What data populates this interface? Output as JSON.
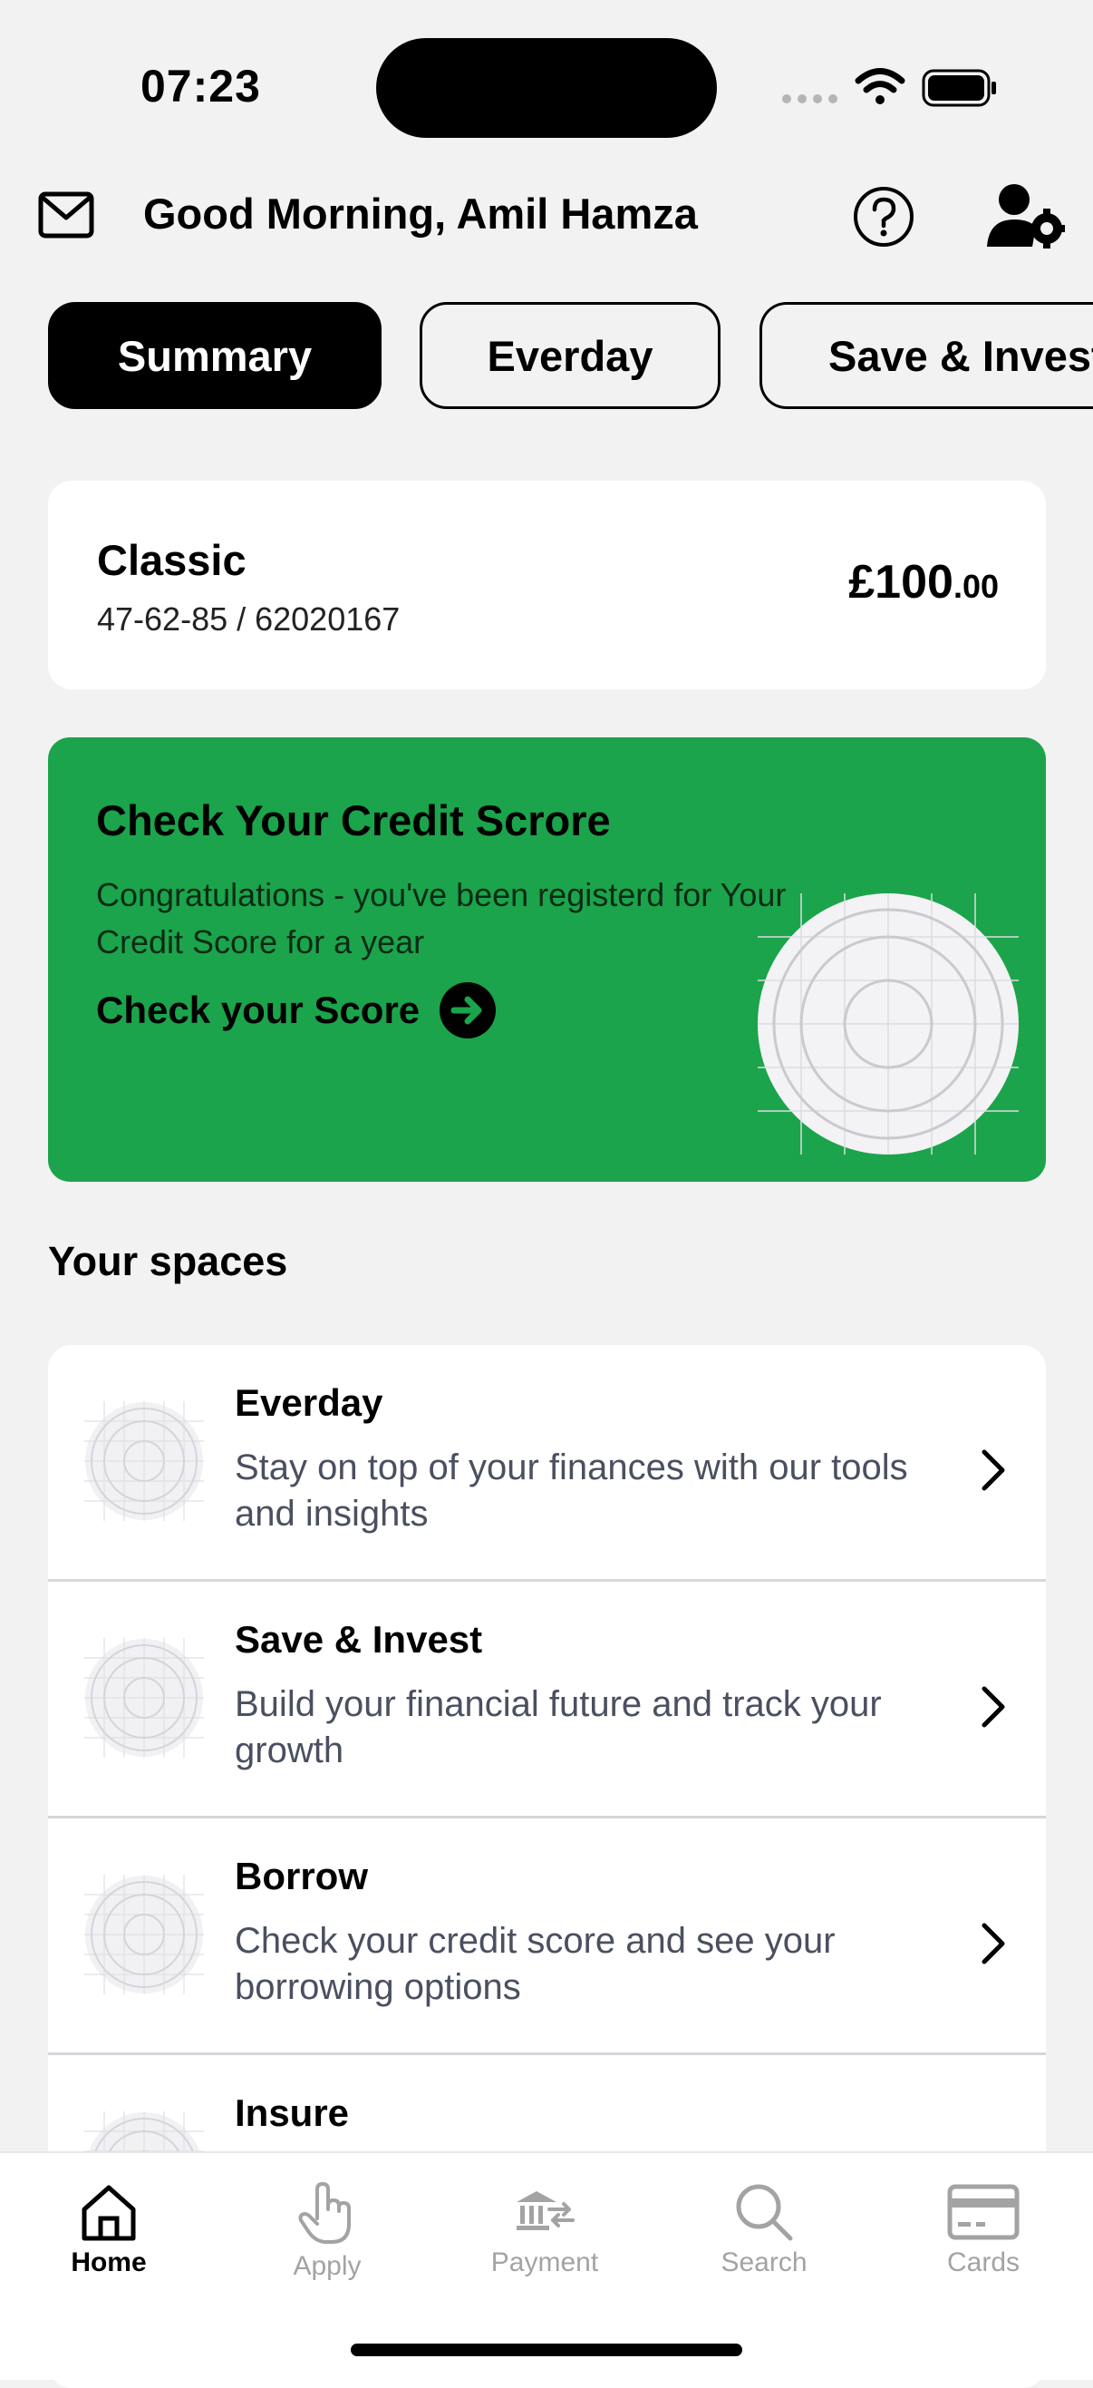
{
  "status_bar": {
    "time": "07:23"
  },
  "header": {
    "greeting": "Good Morning, Amil Hamza"
  },
  "tabs": [
    {
      "label": "Summary",
      "active": true
    },
    {
      "label": "Everday",
      "active": false
    },
    {
      "label": "Save & Invest",
      "active": false
    }
  ],
  "account": {
    "name": "Classic",
    "number": "47-62-85 / 62020167",
    "balance_main": "£100",
    "balance_pence": ".00"
  },
  "credit_banner": {
    "title": "Check Your Credit Scrore",
    "text": "Congratulations - you've been registerd for Your Credit Score for a year",
    "link": "Check your Score",
    "color": "#1ba44b"
  },
  "spaces": {
    "title": "Your spaces",
    "items": [
      {
        "title": "Everday",
        "description": "Stay on top of your finances with our tools and insights"
      },
      {
        "title": "Save & Invest",
        "description": "Build your financial future and track your growth"
      },
      {
        "title": "Borrow",
        "description": "Check your credit score and see your borrowing options"
      },
      {
        "title": "Insure",
        "description": ""
      }
    ]
  },
  "nav": [
    {
      "label": "Home",
      "icon": "home-icon",
      "active": true
    },
    {
      "label": "Apply",
      "icon": "hand-pointer-icon",
      "active": false
    },
    {
      "label": "Payment",
      "icon": "bank-transfer-icon",
      "active": false
    },
    {
      "label": "Search",
      "icon": "search-icon",
      "active": false
    },
    {
      "label": "Cards",
      "icon": "card-icon",
      "active": false
    }
  ]
}
